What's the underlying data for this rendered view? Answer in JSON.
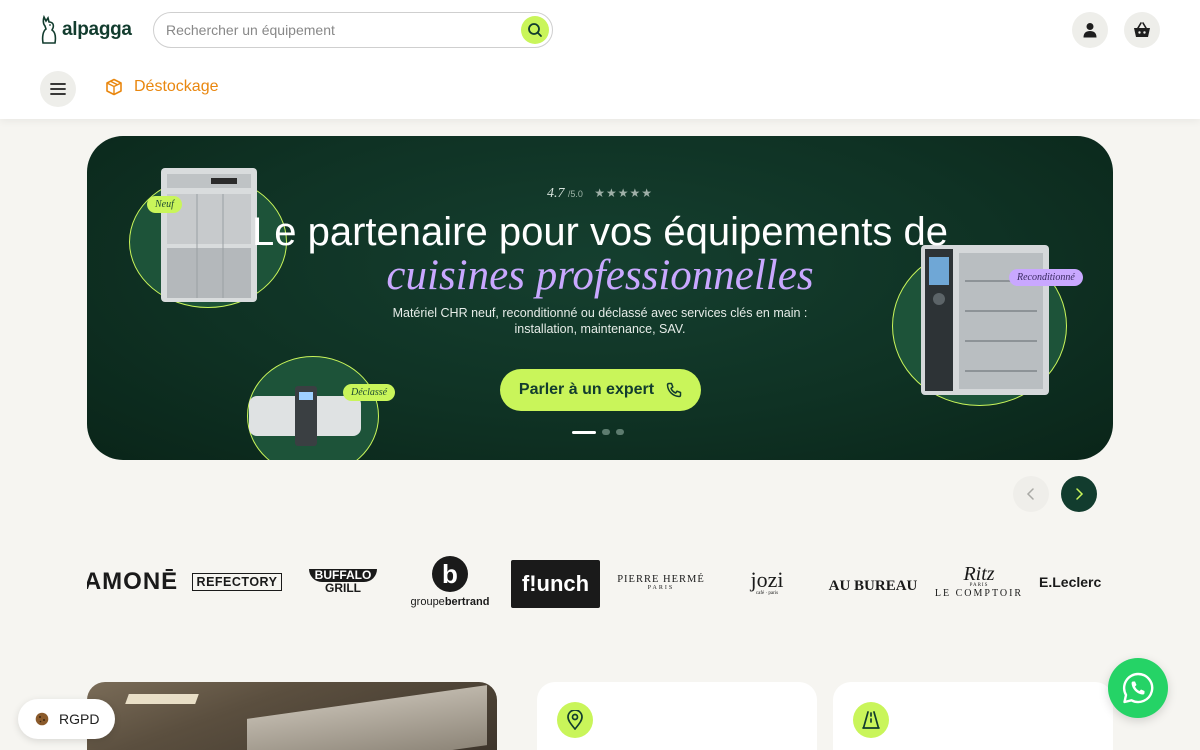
{
  "header": {
    "logo_text": "alpagga",
    "search": {
      "placeholder": "Rechercher un équipement",
      "value": ""
    },
    "destockage_label": "Déstockage"
  },
  "hero": {
    "rating_score": "4.7",
    "rating_outof": "/5.0",
    "rating_stars": "★★★★★",
    "title_line1": "Le partenaire pour vos équipements de",
    "title_line2": "cuisines professionnelles",
    "subtitle_line1": "Matériel CHR neuf, reconditionné ou déclassé avec services clés en main :",
    "subtitle_line2": "installation, maintenance, SAV.",
    "cta_label": "Parler à un expert",
    "tags": {
      "neuf": "Neuf",
      "declasse": "Déclassé",
      "reconditionne": "Reconditionné"
    },
    "slides_total": 3,
    "slide_active": 1
  },
  "brands": [
    "AMONĒ",
    "REFECTORY",
    "BUFFALO GRILL",
    "groupe bertrand",
    "f!unch",
    "PIERRE HERMÉ",
    "jozi",
    "AU BUREAU",
    "Ritz Le Comptoir",
    "E.Leclerc"
  ],
  "brands_sub": {
    "pierre_herme": "PARIS",
    "jozi": "café · paris",
    "ritz_script": "Ritz",
    "ritz_paris": "PARIS",
    "ritz_main": "LE COMPTOIR",
    "groupe_a": "groupe",
    "groupe_b": "bertrand",
    "groupe_letter": "b",
    "buffalo_a": "BUFFALO",
    "buffalo_b": "GRILL"
  },
  "footer_widgets": {
    "rgpd_label": "RGPD"
  },
  "colors": {
    "accent_lime": "#c9f55a",
    "accent_purple": "#c9a8ff",
    "brand_green": "#123c2e",
    "destock_orange": "#e9870f",
    "hero_bg": "#0f3224",
    "whatsapp": "#25d366"
  },
  "icons": [
    "search-icon",
    "user-icon",
    "basket-icon",
    "menu-icon",
    "box-icon",
    "phone-icon",
    "chevron-left-icon",
    "chevron-right-icon",
    "map-pin-icon",
    "road-icon",
    "cookie-icon",
    "whatsapp-icon"
  ]
}
